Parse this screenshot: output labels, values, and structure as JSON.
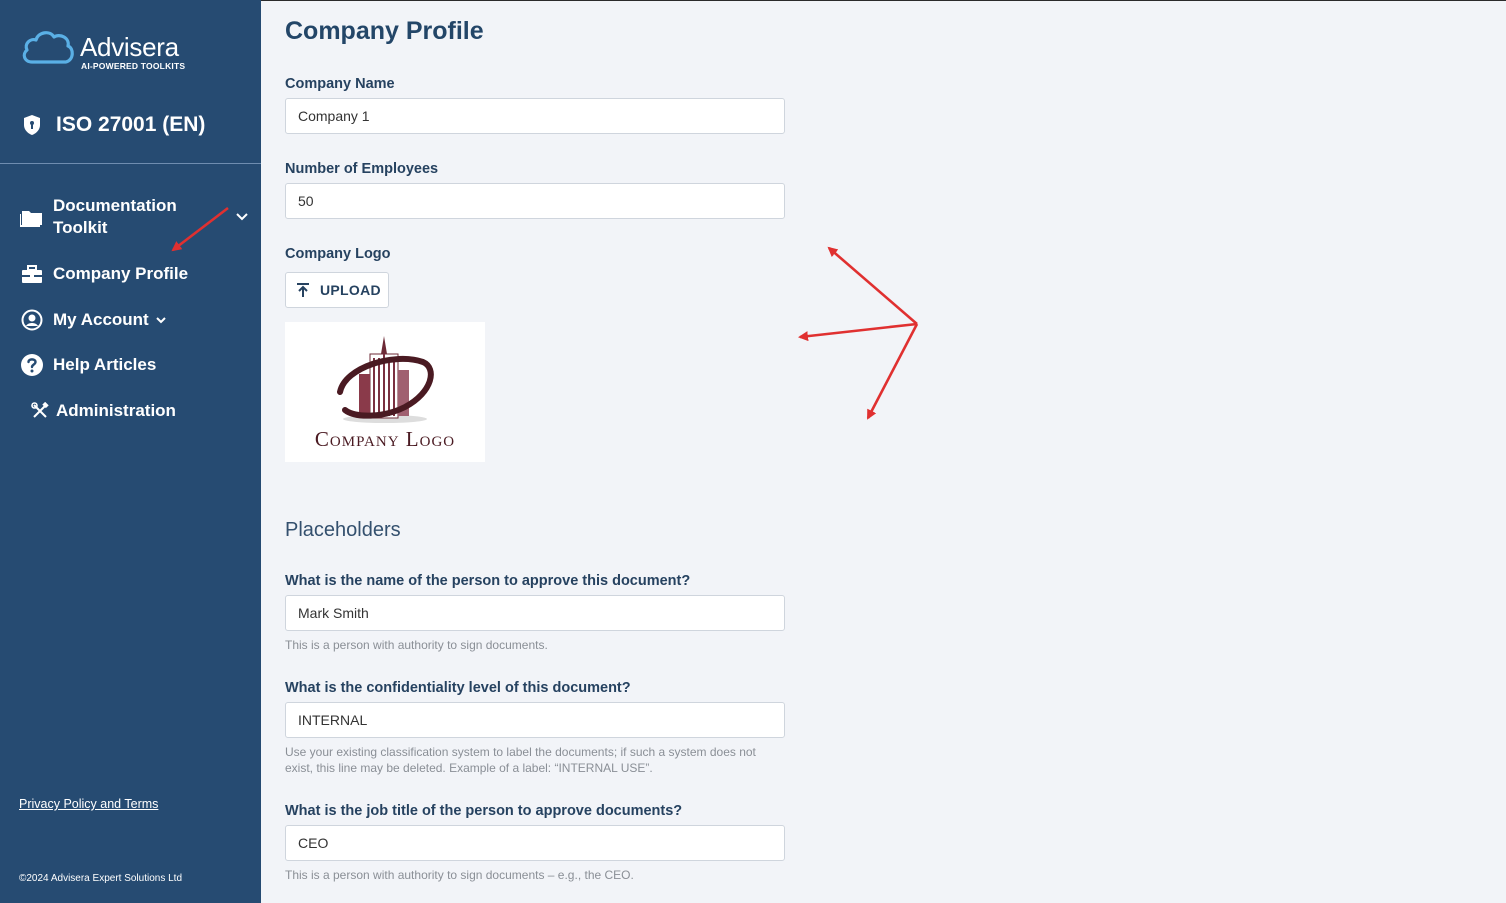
{
  "sidebar": {
    "brand": {
      "name": "Advisera",
      "tagline": "AI-POWERED TOOLKITS"
    },
    "product": {
      "label": "ISO 27001 (EN)",
      "icon": "shield-icon"
    },
    "nav": [
      {
        "label": "Documentation Toolkit",
        "icon": "folder-icon"
      },
      {
        "label": "Company Profile",
        "icon": "briefcase-icon"
      },
      {
        "label": "My Account",
        "icon": "user-circle-icon"
      },
      {
        "label": "Help Articles",
        "icon": "question-circle-icon"
      },
      {
        "label": "Administration",
        "icon": "tools-icon"
      }
    ],
    "privacy_link": "Privacy Policy and Terms",
    "copyright": "©2024 Advisera Expert Solutions Ltd"
  },
  "main": {
    "title": "Company Profile",
    "company_name": {
      "label": "Company Name",
      "value": "Company 1"
    },
    "employees": {
      "label": "Number of Employees",
      "value": "50"
    },
    "logo": {
      "label": "Company Logo",
      "upload_label": "UPLOAD",
      "image_text": "Company Logo"
    },
    "placeholders": {
      "title": "Placeholders",
      "approver_name": {
        "label": "What is the name of the person to approve this document?",
        "value": "Mark Smith",
        "help": "This is a person with authority to sign documents."
      },
      "confidentiality": {
        "label": "What is the confidentiality level of this document?",
        "value": "INTERNAL",
        "help": "Use your existing classification system to label the documents; if such a system does not exist, this line may be deleted. Example of a label: “INTERNAL USE”."
      },
      "job_title": {
        "label": "What is the job title of the person to approve documents?",
        "value": "CEO",
        "help": "This is a person with authority to sign documents – e.g., the CEO."
      }
    }
  },
  "colors": {
    "sidebar": "#264b72",
    "page_bg": "#f2f4f8",
    "heading": "#234668",
    "annotation": "#e03030",
    "logo_maroon": "#4a1a22"
  }
}
